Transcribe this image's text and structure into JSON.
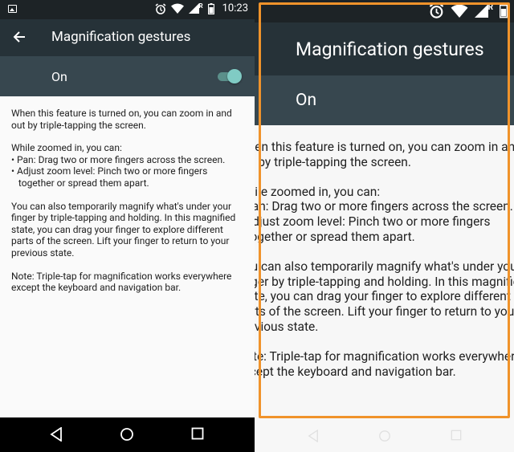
{
  "status_bar": {
    "time": "10:23",
    "signal_badge": "R"
  },
  "toolbar": {
    "title": "Magnification gestures"
  },
  "master_switch": {
    "label": "On",
    "checked": true
  },
  "body": {
    "paragraph1": [
      "When this feature is turned on, you can zoom in and",
      "out by triple-tapping the screen."
    ],
    "paragraph2": [
      "While zoomed in, you can:",
      "• Pan: Drag two or more fingers across the screen.",
      "• Adjust zoom level: Pinch two or more fingers",
      "   together or spread them apart."
    ],
    "paragraph3": [
      "You can also temporarily magnify what's under your",
      "finger by triple-tapping and holding. In this magnified",
      "state, you can drag your finger to explore different",
      "parts of the screen. Lift your finger to return to your",
      "previous state."
    ],
    "paragraph4": [
      "Note: Triple-tap for magnification works everywhere",
      "except the keyboard and navigation bar."
    ]
  },
  "colors": {
    "status_bar": "#1d2326",
    "toolbar": "#263238",
    "switch_bar": "#37474f",
    "accent": "#80cbc4",
    "magnify_frame": "#f0932b"
  },
  "icons": [
    "image-icon",
    "alarm-icon",
    "wifi-icon",
    "signal-icon",
    "battery-icon",
    "back-arrow-icon",
    "nav-back-icon",
    "nav-home-icon",
    "nav-recents-icon"
  ]
}
